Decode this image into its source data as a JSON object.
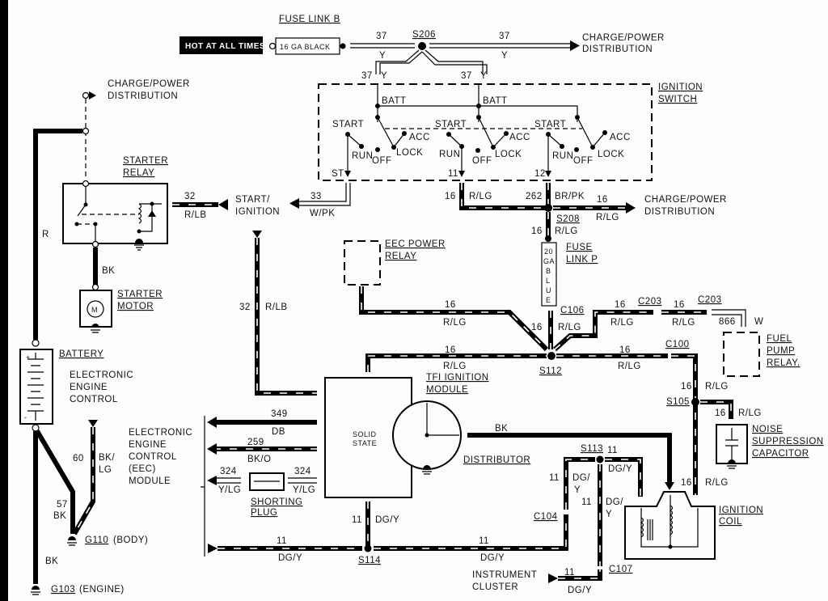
{
  "diagram": {
    "top": {
      "hot_label": "HOT AT ALL TIMES",
      "fuse_link_b": "FUSE LINK B",
      "fuse_link_b_spec": "16 GA BLACK",
      "s206": "S206",
      "wire_37": "37",
      "wire_y": "Y",
      "charge_power_1": "CHARGE/POWER",
      "distribution_1": "DISTRIBUTION"
    },
    "ignition_switch": {
      "title_1": "IGNITION",
      "title_2": "SWITCH",
      "batt": "BATT",
      "start": "START",
      "acc": "ACC",
      "run": "RUN",
      "off": "OFF",
      "lock": "LOCK",
      "out_st": "ST",
      "out_11": "11",
      "out_12": "12"
    },
    "left_top": {
      "charge_power": "CHARGE/POWER",
      "distribution": "DISTRIBUTION",
      "starter_relay_1": "STARTER",
      "starter_relay_2": "RELAY",
      "wire_r": "R",
      "wire_bk": "BK",
      "starter_motor_1": "STARTER",
      "starter_motor_2": "MOTOR",
      "motor_symbol": "M",
      "w32": "32",
      "w32_color": "R/LB",
      "start_ignition_1": "START/",
      "start_ignition_2": "IGNITION",
      "w33": "33",
      "w33_color": "W/PK"
    },
    "center": {
      "w16": "16",
      "r_lg": "R/LG",
      "w262": "262",
      "br_pk": "BR/PK",
      "s208": "S208",
      "charge_power": "CHARGE/POWER",
      "distribution": "DISTRIBUTION",
      "fuse_link_p_1": "FUSE",
      "fuse_link_p_2": "LINK P",
      "fuse_p_spec": [
        "20",
        "GA",
        "B",
        "L",
        "U",
        "E"
      ],
      "eec_power_relay_1": "EEC POWER",
      "eec_power_relay_2": "RELAY",
      "c106": "C106",
      "c203": "C203",
      "c100": "C100",
      "s112": "S112",
      "w866": "866",
      "w_w": "W"
    },
    "right": {
      "fuel_pump_relay_1": "FUEL",
      "fuel_pump_relay_2": "PUMP",
      "fuel_pump_relay_3": "RELAY.",
      "s105": "S105",
      "noise_1": "NOISE",
      "noise_2": "SUPPRESSION",
      "noise_3": "CAPACITOR",
      "ignition_coil_1": "IGNITION",
      "ignition_coil_2": "COIL"
    },
    "module": {
      "tfi_1": "TFI IGNITION",
      "tfi_2": "MODULE",
      "solid_1": "SOLID",
      "solid_2": "STATE",
      "distributor": "DISTRIBUTOR",
      "bk": "BK",
      "w32": "32",
      "w32_color": "R/LB",
      "w349": "349",
      "db": "DB",
      "w259": "259",
      "bk_o": "BK/O",
      "w324": "324",
      "y_lg": "Y/LG",
      "shorting_1": "SHORTING",
      "shorting_2": "PLUG",
      "eec_module_1": "ELECTRONIC",
      "eec_module_2": "ENGINE",
      "eec_module_3": "CONTROL",
      "eec_module_4": "(EEC)",
      "eec_module_5": "MODULE"
    },
    "bottom": {
      "w11": "11",
      "dg_y": "DG/Y",
      "dg_slash": "DG/",
      "y": "Y",
      "s114": "S114",
      "s113": "S113",
      "c104": "C104",
      "c107": "C107",
      "instrument_1": "INSTRUMENT",
      "instrument_2": "CLUSTER"
    },
    "battery": {
      "label": "BATTERY",
      "eec_1": "ELECTRONIC",
      "eec_2": "ENGINE",
      "eec_3": "CONTROL",
      "w60": "60",
      "bk_slash": "BK/",
      "lg": "LG",
      "w57": "57",
      "bk": "BK",
      "g110": "G110",
      "g110_desc": "(BODY)",
      "g103": "G103",
      "g103_desc": "(ENGINE)",
      "plus": "+",
      "minus": "-"
    }
  }
}
